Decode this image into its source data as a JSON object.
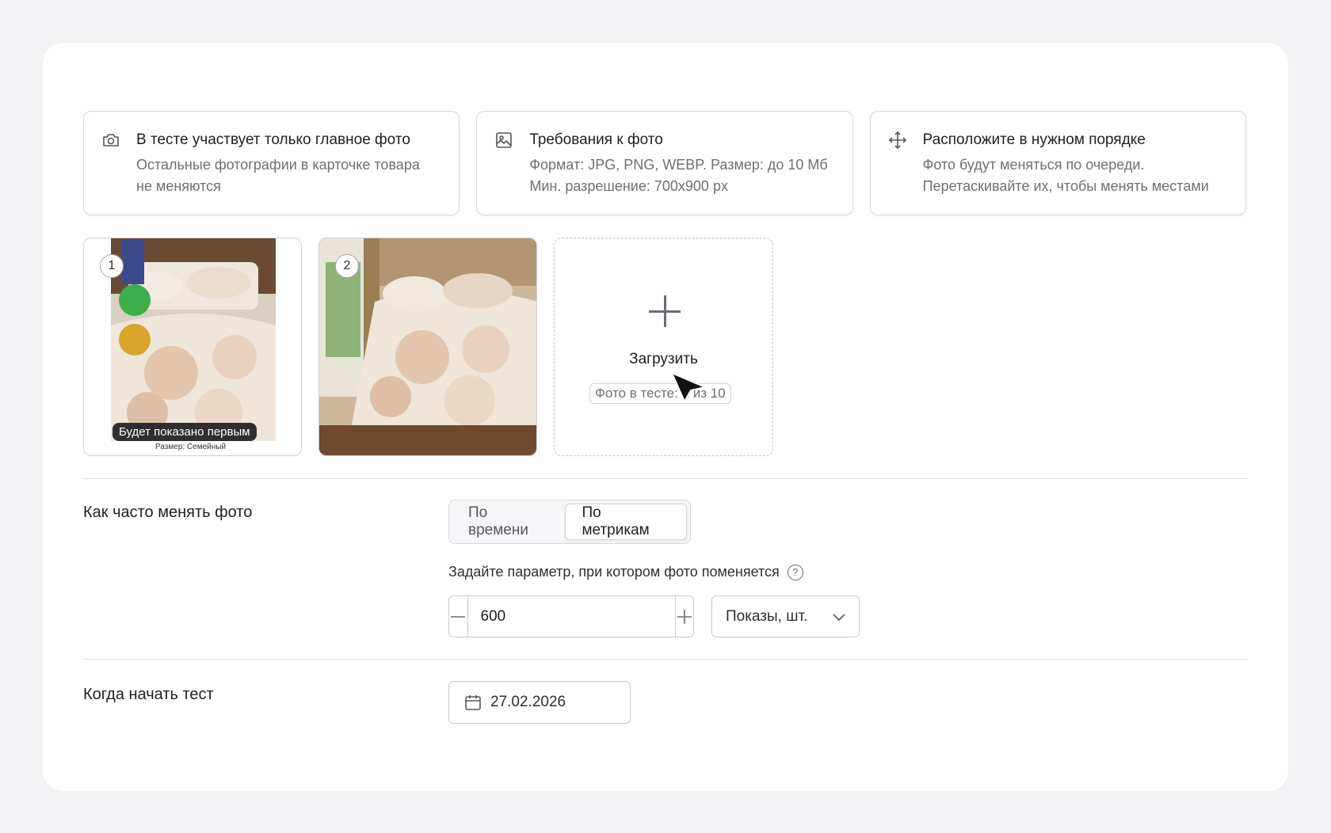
{
  "info_cards": [
    {
      "icon": "camera-icon",
      "title": "В тесте участвует только главное фото",
      "text": [
        "Остальные фотографии в карточке товара",
        "не меняются"
      ]
    },
    {
      "icon": "image-icon",
      "title": "Требования к фото",
      "text": [
        "Формат: JPG, PNG, WEBP. Размер: до 10 Мб",
        "Мин. разрешение: 700х900 px"
      ]
    },
    {
      "icon": "move-icon",
      "title": "Расположите в нужном порядке",
      "text": [
        "Фото будут меняться по очереди.",
        "Перетаскивайте их, чтобы менять местами"
      ]
    }
  ],
  "photos": [
    {
      "number": "1",
      "first_label": "Будет показано первым",
      "size_label": "Размер: Семейный"
    },
    {
      "number": "2"
    }
  ],
  "upload": {
    "label": "Загрузить",
    "counter": "Фото в тесте: 2 из 10"
  },
  "frequency": {
    "label": "Как часто менять фото",
    "options": [
      "По времени",
      "По метрикам"
    ],
    "selected": "По метрикам",
    "param_label": "Задайте параметр, при котором фото поменяется",
    "value": "600",
    "unit": "Показы, шт."
  },
  "start": {
    "label": "Когда начать тест",
    "date": "27.02.2026"
  }
}
